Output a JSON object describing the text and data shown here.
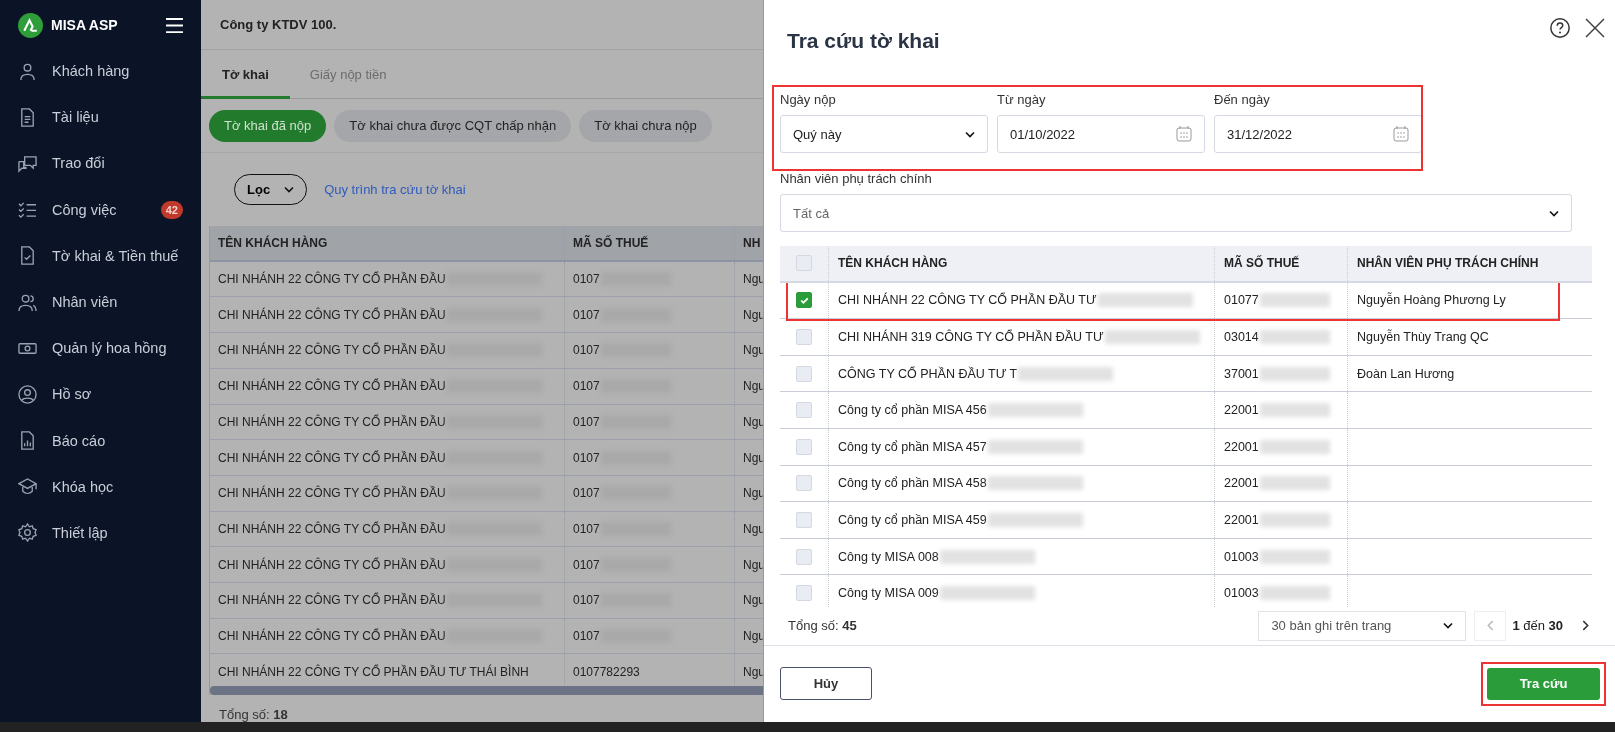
{
  "sidebar": {
    "logo": "MISA ASP",
    "items": [
      {
        "label": "Khách hàng"
      },
      {
        "label": "Tài liệu"
      },
      {
        "label": "Trao đổi"
      },
      {
        "label": "Công việc",
        "badge": "42"
      },
      {
        "label": "Tờ khai & Tiền thuế"
      },
      {
        "label": "Nhân viên"
      },
      {
        "label": "Quản lý hoa hồng"
      },
      {
        "label": "Hồ sơ"
      },
      {
        "label": "Báo cáo"
      },
      {
        "label": "Khóa học"
      },
      {
        "label": "Thiết lập"
      }
    ]
  },
  "main": {
    "company": "Công ty KTDV 100.",
    "tabs": [
      {
        "label": "Tờ khai",
        "selected": true
      },
      {
        "label": "Giấy nộp tiền",
        "selected": false
      }
    ],
    "chips": [
      {
        "label": "Tờ khai đã nộp",
        "selected": true
      },
      {
        "label": "Tờ khai chưa được CQT chấp nhận",
        "selected": false
      },
      {
        "label": "Tờ khai chưa nộp",
        "selected": false
      }
    ],
    "filter": "Lọc",
    "link": "Quy trình tra cứu tờ khai",
    "table": {
      "columns": [
        "TÊN KHÁCH HÀNG",
        "MÃ SỐ THUẾ",
        "NH"
      ],
      "rows": [
        {
          "name": "CHI NHÁNH 22 CÔNG TY CỔ PHẦN ĐẦU",
          "tax": "0107",
          "col3": "Ngu",
          "redacted": true
        },
        {
          "name": "CHI NHÁNH 22 CÔNG TY CỔ PHẦN ĐẦU",
          "tax": "0107",
          "col3": "Ngu",
          "redacted": true
        },
        {
          "name": "CHI NHÁNH 22 CÔNG TY CỔ PHẦN ĐẦU",
          "tax": "0107",
          "col3": "Ngu",
          "redacted": true
        },
        {
          "name": "CHI NHÁNH 22 CÔNG TY CỔ PHẦN ĐẦU",
          "tax": "0107",
          "col3": "Ngu",
          "redacted": true
        },
        {
          "name": "CHI NHÁNH 22 CÔNG TY CỔ PHẦN ĐẦU",
          "tax": "0107",
          "col3": "Ngu",
          "redacted": true
        },
        {
          "name": "CHI NHÁNH 22 CÔNG TY CỔ PHẦN ĐẦU",
          "tax": "0107",
          "col3": "Ngu",
          "redacted": true
        },
        {
          "name": "CHI NHÁNH 22 CÔNG TY CỔ PHẦN ĐẦU",
          "tax": "0107",
          "col3": "Ngu",
          "redacted": true
        },
        {
          "name": "CHI NHÁNH 22 CÔNG TY CỔ PHẦN ĐẦU",
          "tax": "0107",
          "col3": "Ngu",
          "redacted": true
        },
        {
          "name": "CHI NHÁNH 22 CÔNG TY CỔ PHẦN ĐẦU",
          "tax": "0107",
          "col3": "Ngu",
          "redacted": true
        },
        {
          "name": "CHI NHÁNH 22 CÔNG TY CỔ PHẦN ĐẦU",
          "tax": "0107",
          "col3": "Ngu",
          "redacted": true
        },
        {
          "name": "CHI NHÁNH 22 CÔNG TY CỔ PHẦN ĐẦU",
          "tax": "0107",
          "col3": "Ngu",
          "redacted": true
        },
        {
          "name": "CHI NHÁNH 22 CÔNG TY CỔ PHẦN ĐẦU TƯ THÁI BÌNH",
          "tax": "0107782293",
          "col3": "Ngu",
          "redacted": false
        }
      ]
    },
    "total_label": "Tổng số:",
    "total": "18"
  },
  "dialog": {
    "title": "Tra cứu tờ khai",
    "fields": [
      {
        "label": "Ngày nộp",
        "value": "Quý này",
        "kind": "select"
      },
      {
        "label": "Từ ngày",
        "value": "01/10/2022",
        "kind": "date"
      },
      {
        "label": "Đến ngày",
        "value": "31/12/2022",
        "kind": "date"
      }
    ],
    "staff": {
      "label": "Nhân viên phụ trách chính",
      "value": "Tất cả"
    },
    "table": {
      "columns": [
        "TÊN KHÁCH HÀNG",
        "MÃ SỐ THUẾ",
        "NHÂN VIÊN PHỤ TRÁCH CHÍNH"
      ],
      "all_checked": false,
      "rows": [
        {
          "checked": true,
          "name": "CHI NHÁNH 22 CÔNG TY CỔ PHẦN ĐẦU TƯ",
          "tax": "01077",
          "staff": "Nguyễn Hoàng Phương Ly",
          "redacted": true
        },
        {
          "checked": false,
          "name": "CHI NHÁNH 319 CÔNG TY CỔ PHẦN ĐẦU TƯ",
          "tax": "03014",
          "staff": "Nguyễn Thùy Trang QC",
          "redacted": true
        },
        {
          "checked": false,
          "name": "CÔNG TY CỔ PHẦN ĐẦU TƯ T",
          "tax": "37001",
          "staff": "Đoàn Lan Hương",
          "redacted": true
        },
        {
          "checked": false,
          "name": "Công ty cổ phần MISA 456",
          "tax": "22001",
          "redacted": true
        },
        {
          "checked": false,
          "name": "Công ty cổ phần MISA 457",
          "tax": "22001",
          "redacted": true
        },
        {
          "checked": false,
          "name": "Công ty cổ phần MISA 458",
          "tax": "22001",
          "redacted": true
        },
        {
          "checked": false,
          "name": "Công ty cổ phần MISA 459",
          "tax": "22001",
          "redacted": true
        },
        {
          "checked": false,
          "name": "Công ty MISA 008",
          "tax": "01003",
          "redacted": true
        },
        {
          "checked": false,
          "name": "Công ty MISA 009",
          "tax": "01003",
          "redacted": true
        }
      ]
    },
    "total_label": "Tổng số:",
    "total": "45",
    "page_size": "30 bản ghi trên trang",
    "pager": "**1** đến **30**",
    "cancel": "Hủy",
    "submit": "Tra cứu"
  }
}
